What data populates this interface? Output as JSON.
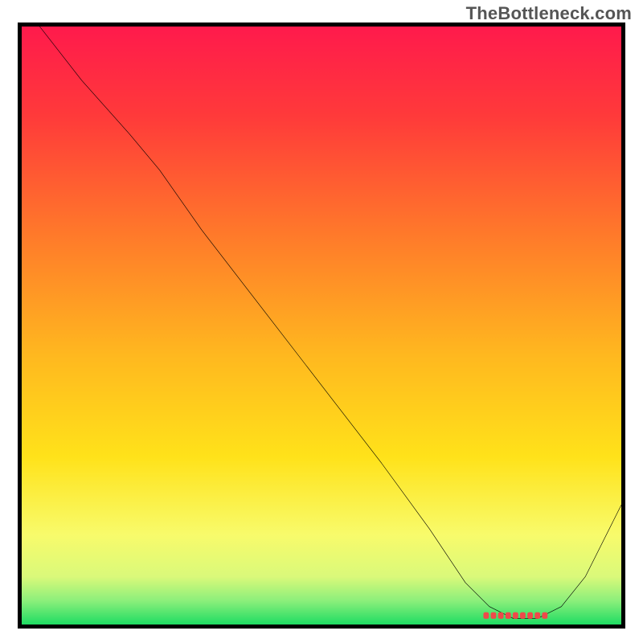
{
  "watermark": "TheBottleneck.com",
  "colors": {
    "gradient_stops": [
      {
        "offset": 0.0,
        "color": "#ff1a4c"
      },
      {
        "offset": 0.15,
        "color": "#ff3a3a"
      },
      {
        "offset": 0.35,
        "color": "#ff7a2a"
      },
      {
        "offset": 0.55,
        "color": "#ffb81f"
      },
      {
        "offset": 0.72,
        "color": "#ffe21a"
      },
      {
        "offset": 0.85,
        "color": "#f8fb6b"
      },
      {
        "offset": 0.92,
        "color": "#daf97a"
      },
      {
        "offset": 0.96,
        "color": "#8cef7b"
      },
      {
        "offset": 1.0,
        "color": "#1fdc63"
      }
    ],
    "curve": "#000000",
    "marker": "#ef4a4a",
    "frame": "#000000"
  },
  "chart_data": {
    "type": "line",
    "title": "",
    "xlabel": "",
    "ylabel": "",
    "xlim": [
      0,
      100
    ],
    "ylim": [
      0,
      100
    ],
    "grid": false,
    "series": [
      {
        "name": "bottleneck-curve",
        "x": [
          3,
          10,
          18,
          23,
          30,
          40,
          50,
          60,
          68,
          74,
          78,
          82,
          86,
          90,
          94,
          100
        ],
        "y": [
          100,
          91,
          82,
          76,
          66,
          53,
          40,
          27,
          16,
          7,
          3,
          1,
          1,
          3,
          8,
          20
        ]
      }
    ],
    "optimal_marker": {
      "x_start": 77,
      "x_end": 88,
      "y": 1.5
    }
  }
}
